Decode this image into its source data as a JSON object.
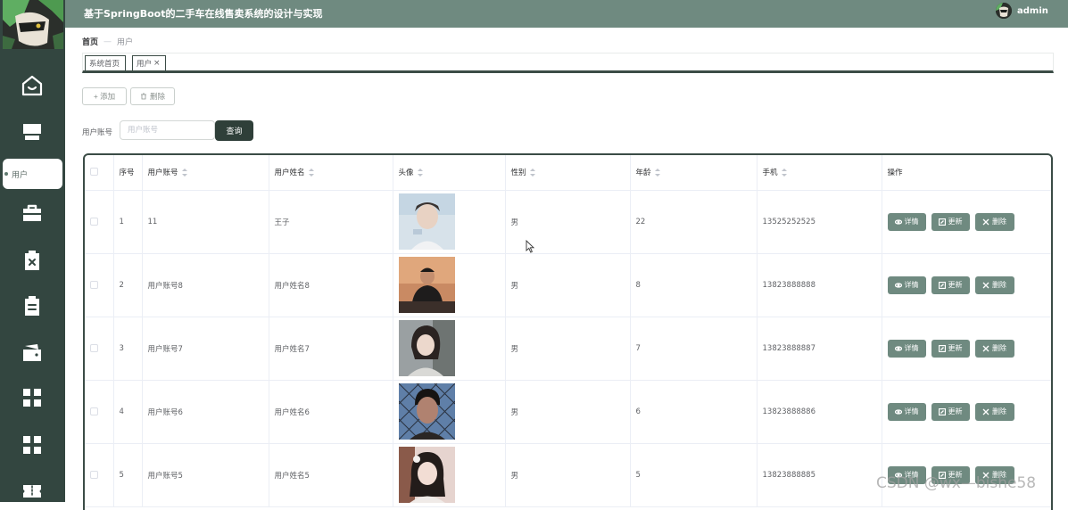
{
  "header": {
    "title": "基于SpringBoot的二手车在线售卖系统的设计与实现",
    "username": "admin"
  },
  "sidebar": {
    "items": [
      {
        "icon": "home-icon"
      },
      {
        "icon": "store-icon"
      },
      {
        "icon": "user-dot-icon",
        "label": "用户",
        "active": true
      },
      {
        "icon": "briefcase-icon"
      },
      {
        "icon": "clipboard-x-icon"
      },
      {
        "icon": "clipboard-icon"
      },
      {
        "icon": "wallet-icon"
      },
      {
        "icon": "grid-icon"
      },
      {
        "icon": "grid-icon"
      },
      {
        "icon": "ticket-icon"
      }
    ]
  },
  "breadcrumb": {
    "home": "首页",
    "separator": "—",
    "current": "用户"
  },
  "tabs": [
    {
      "label": "系统首页"
    },
    {
      "label": "用户",
      "close": "×"
    }
  ],
  "actions": {
    "add_label": "+ 添加",
    "delete_label": "删除"
  },
  "search": {
    "label": "用户账号",
    "placeholder": "用户账号",
    "value": "",
    "button_label": "查询"
  },
  "table": {
    "columns": [
      "序号",
      "用户账号",
      "用户姓名",
      "头像",
      "性别",
      "年龄",
      "手机",
      "操作"
    ],
    "rows": [
      {
        "index": "1",
        "account": "11",
        "name": "王子",
        "gender": "男",
        "age": "22",
        "phone": "13525252525"
      },
      {
        "index": "2",
        "account": "用户账号8",
        "name": "用户姓名8",
        "gender": "男",
        "age": "8",
        "phone": "13823888888"
      },
      {
        "index": "3",
        "account": "用户账号7",
        "name": "用户姓名7",
        "gender": "男",
        "age": "7",
        "phone": "13823888887"
      },
      {
        "index": "4",
        "account": "用户账号6",
        "name": "用户姓名6",
        "gender": "男",
        "age": "6",
        "phone": "13823888886"
      },
      {
        "index": "5",
        "account": "用户账号5",
        "name": "用户姓名5",
        "gender": "男",
        "age": "5",
        "phone": "13823888885"
      }
    ],
    "row_actions": {
      "detail": "详情",
      "update": "更新",
      "delete": "删除"
    }
  },
  "watermark": "CSDN @wx—bishe58",
  "colors": {
    "sidebar_bg": "#334640",
    "header_bg": "#6f8a80",
    "primary_dark": "#2f3f39",
    "op_button": "#6f8a80"
  }
}
